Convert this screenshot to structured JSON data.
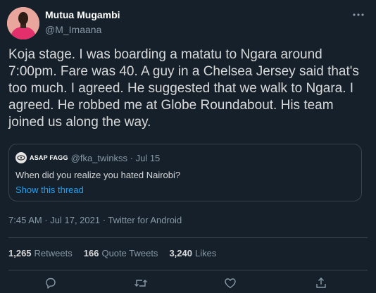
{
  "author": {
    "name": "Mutua Mugambi",
    "handle": "@M_Imaana"
  },
  "tweet_text": "Koja stage. I was boarding a matatu to Ngara around 7:00pm. Fare was 40. A guy in a Chelsea Jersey  said that's too much. I agreed. He suggested that we walk to Ngara. I agreed. He robbed me at Globe Roundabout. His team joined us along the way.",
  "quoted": {
    "name": "ASAP FAGG",
    "meta": "@fka_twinkss · Jul 15",
    "text": "When did you realize you hated Nairobi?",
    "link": "Show this thread"
  },
  "timestamp": "7:45 AM · Jul 17, 2021 · Twitter for Android",
  "stats": {
    "retweets": {
      "count": "1,265",
      "label": "Retweets"
    },
    "quotes": {
      "count": "166",
      "label": "Quote Tweets"
    },
    "likes": {
      "count": "3,240",
      "label": "Likes"
    }
  },
  "colors": {
    "background": "#15202b",
    "text": "#d9d9d9",
    "muted": "#8899a6",
    "link": "#1da1f2",
    "border": "#38444d"
  },
  "icons": [
    "more-icon",
    "reply-icon",
    "retweet-icon",
    "like-icon",
    "share-icon"
  ]
}
